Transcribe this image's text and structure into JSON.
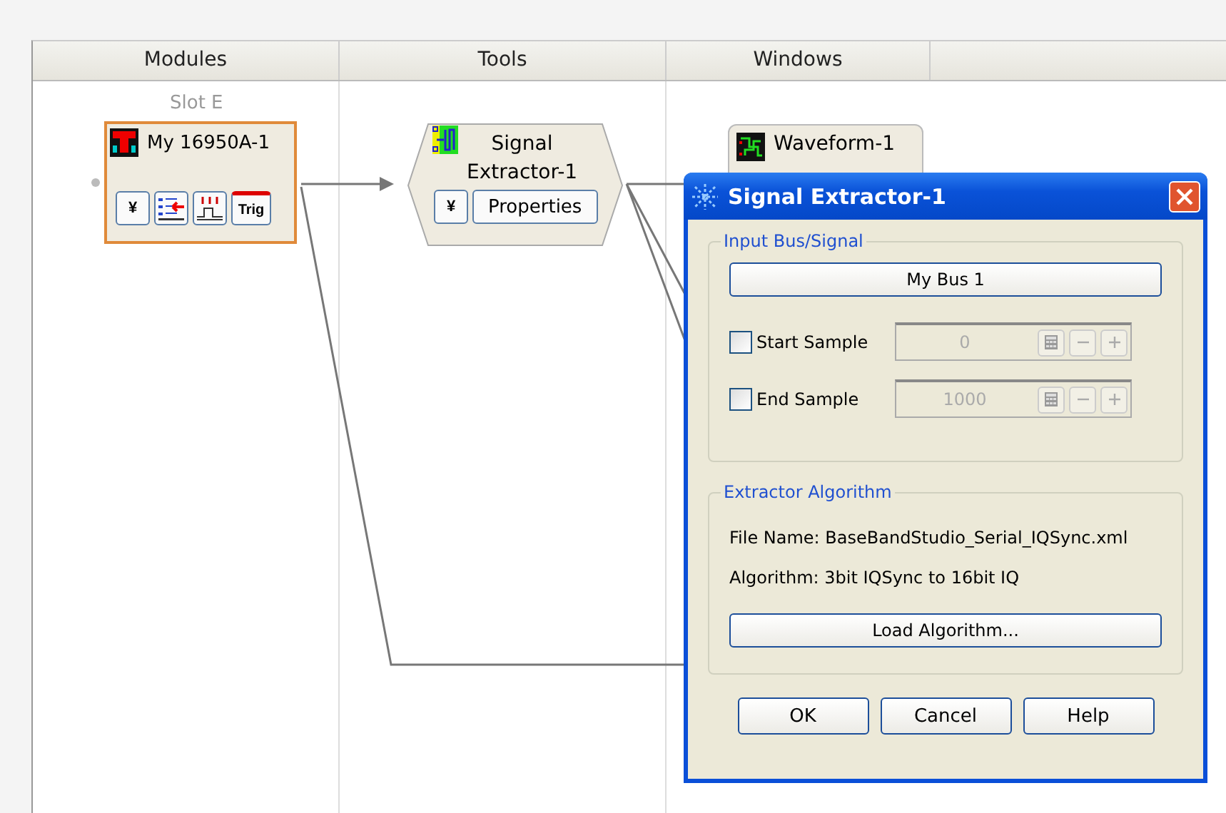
{
  "columns": [
    {
      "label": "Modules"
    },
    {
      "label": "Tools"
    },
    {
      "label": "Windows"
    }
  ],
  "module": {
    "slot": "Slot E",
    "name": "My 16950A-1",
    "expand_glyph": "¥",
    "trig_label": "Trig"
  },
  "tool": {
    "name": "Signal\nExtractor-1",
    "expand_glyph": "¥",
    "button": "Properties"
  },
  "window_node": {
    "name": "Waveform-1"
  },
  "dialog": {
    "title": "Signal Extractor-1",
    "input_group": {
      "legend": "Input Bus/Signal",
      "bus_button": "My Bus 1",
      "samples": [
        {
          "label": "Start Sample",
          "checked": false,
          "value": "0",
          "disabled": true
        },
        {
          "label": "End Sample",
          "checked": false,
          "value": "1000",
          "disabled": true
        }
      ]
    },
    "algorithm_group": {
      "legend": "Extractor Algorithm",
      "file_name": "File Name: BaseBandStudio_Serial_IQSync.xml",
      "algorithm": "Algorithm: 3bit IQSync to 16bit IQ",
      "load_button": "Load Algorithm..."
    },
    "buttons": [
      "OK",
      "Cancel",
      "Help"
    ]
  }
}
